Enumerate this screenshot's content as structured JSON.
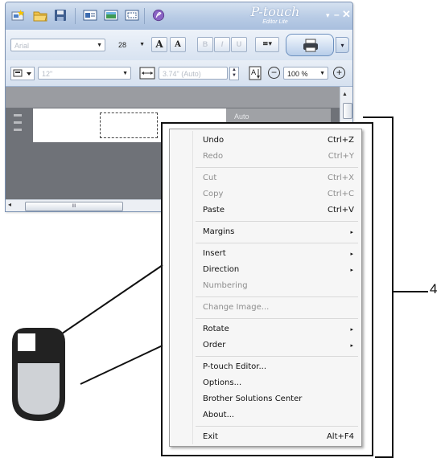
{
  "toolbar": {
    "font_name": "Arial",
    "font_size": "28",
    "grow_label": "A",
    "shrink_label": "A",
    "bold_label": "B",
    "italic_label": "I",
    "underline_label": "U",
    "align_label": "≡▾",
    "print_dropdown": "▾"
  },
  "title_bar": {
    "logo_text": "P-touch",
    "logo_subtext": "Editor Lite",
    "minimize": "–",
    "close": "✕",
    "dropdown": "▾"
  },
  "tape_bar": {
    "tape_size": "12\"",
    "length": "3.74\" (Auto)",
    "zoom": "100 %"
  },
  "workarea": {
    "auto_tag": "Auto"
  },
  "scrollbar": {
    "thumb_label": "III"
  },
  "context_menu": {
    "items": [
      {
        "label": "Undo",
        "shortcut": "Ctrl+Z",
        "disabled": false
      },
      {
        "label": "Redo",
        "shortcut": "Ctrl+Y",
        "disabled": true
      },
      {
        "label": "Cut",
        "shortcut": "Ctrl+X",
        "disabled": true
      },
      {
        "label": "Copy",
        "shortcut": "Ctrl+C",
        "disabled": true
      },
      {
        "label": "Paste",
        "shortcut": "Ctrl+V",
        "disabled": false
      },
      {
        "label": "Margins",
        "submenu": true,
        "disabled": false
      },
      {
        "label": "Insert",
        "submenu": true,
        "disabled": false
      },
      {
        "label": "Direction",
        "submenu": true,
        "disabled": false
      },
      {
        "label": "Numbering",
        "disabled": true
      },
      {
        "label": "Change Image...",
        "disabled": true
      },
      {
        "label": "Rotate",
        "submenu": true,
        "disabled": false
      },
      {
        "label": "Order",
        "submenu": true,
        "disabled": false
      },
      {
        "label": "P-touch Editor...",
        "disabled": false
      },
      {
        "label": "Options...",
        "disabled": false
      },
      {
        "label": "Brother Solutions Center",
        "disabled": false
      },
      {
        "label": "About...",
        "disabled": false
      },
      {
        "label": "Exit",
        "shortcut": "Alt+F4",
        "disabled": false
      }
    ],
    "submenu_arrow": "▸"
  },
  "callout": {
    "number": "4"
  },
  "colors": {
    "title_bar": "#b8cbe5",
    "workarea": "#6f7278",
    "menu_background": "#f6f6f6",
    "disabled_text": "#8d8d8d"
  },
  "icons": [
    "new-label-icon",
    "open-folder-icon",
    "save-icon",
    "layout-icon",
    "database-icon",
    "print-icon",
    "mouse-icon"
  ]
}
